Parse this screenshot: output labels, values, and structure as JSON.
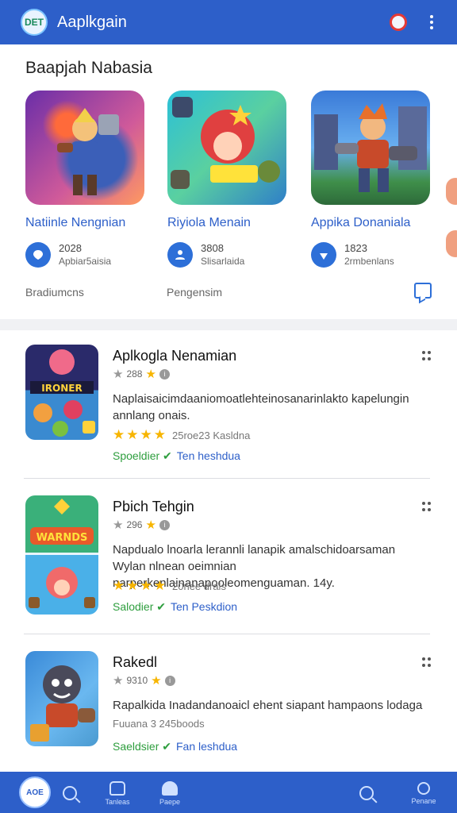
{
  "header": {
    "logo_text": "DET",
    "title": "Aaplkgain"
  },
  "featured": {
    "title": "Baapjah Nabasia",
    "cards": [
      {
        "name": "Natiinle Nengnian",
        "meta_num": "2028",
        "meta_label": "Apbiar5aisia",
        "icon": "pin-icon"
      },
      {
        "name": "Riyiola Menain",
        "meta_num": "3808",
        "meta_label": "Slisarlaida",
        "icon": "user-icon"
      },
      {
        "name": "Appika Donaniala",
        "meta_num": "1823",
        "meta_label": "2rmbenlans",
        "icon": "location-icon"
      }
    ],
    "category_left": "Bradiumcns",
    "category_mid": "Pengensim"
  },
  "apps": [
    {
      "title": "Aplkogla Nenamian",
      "rating_num": "288",
      "description": "Naplaisaicimdaaniomoatlehteinosanarinlakto kapelungin annlang onais.",
      "stars": 4,
      "star_text": "25roe23 Kasldna",
      "tag_green": "Spoeldier",
      "tag_blue": "Ten heshdua",
      "icon_label": "IRONER"
    },
    {
      "title": "Pbich Tehgin",
      "rating_num": "296",
      "description": "Napdualo lnoarla lerannli lanapik amalschidoarsaman Wylan nlnean oeimnian narperkenlainanapooleomenguaman. 14y.",
      "stars": 4,
      "star_text": "20nee drals",
      "tag_green": "Salodier",
      "tag_blue": "Ten Peskdion",
      "icon_label": "WARNDS"
    },
    {
      "title": "Rakedl",
      "rating_num": "9310",
      "description": "Rapalkida Inadandanoaicl ehent siapant hampaons lodaga",
      "stars": 0,
      "star_text": "Fuuana 3 245boods",
      "tag_green": "Saeldsier",
      "tag_blue": "Fan leshdua",
      "icon_label": ""
    }
  ],
  "bottom_nav": {
    "avatar_text": "AOE",
    "item2_label": "Tanleas",
    "item3_label": "Paepe",
    "item5_label": "Penane"
  },
  "colors": {
    "primary": "#2d5fc9",
    "link": "#2d5fc9",
    "accent_green": "#2e9e3e",
    "star": "#f7b500"
  }
}
